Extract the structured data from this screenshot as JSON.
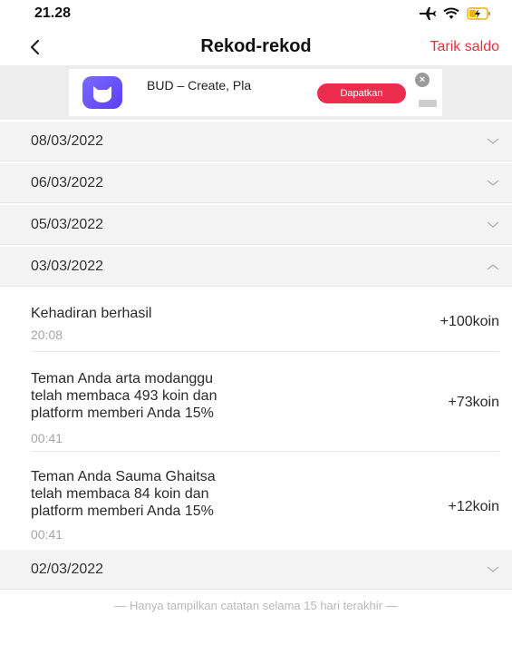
{
  "status": {
    "time": "21.28"
  },
  "nav": {
    "title": "Rekod-rekod",
    "action": "Tarik saldo"
  },
  "ad": {
    "app_name": "BUD – Create, Pla",
    "cta": "Dapatkan",
    "close_symbol": "×"
  },
  "dates": [
    "08/03/2022",
    "06/03/2022",
    "05/03/2022",
    "03/03/2022",
    "02/03/2022"
  ],
  "records": [
    {
      "lines": [
        "Kehadiran berhasil"
      ],
      "time": "20:08",
      "amount": "+100koin"
    },
    {
      "lines": [
        "Teman Anda arta modanggu",
        "telah membaca 493 koin dan",
        "platform memberi Anda 15%"
      ],
      "time": "00:41",
      "amount": "+73koin"
    },
    {
      "lines": [
        "Teman Anda Sauma Ghaitsa",
        "telah membaca 84 koin dan",
        "platform memberi Anda 15%"
      ],
      "time": "00:41",
      "amount": "+12koin"
    }
  ],
  "footer": "— Hanya tampilkan catatan selama 15 hari terakhir —",
  "colors": {
    "accent": "#e0343a",
    "ad_button": "#ec2d4d",
    "ad_logo": "#6a55f7"
  }
}
